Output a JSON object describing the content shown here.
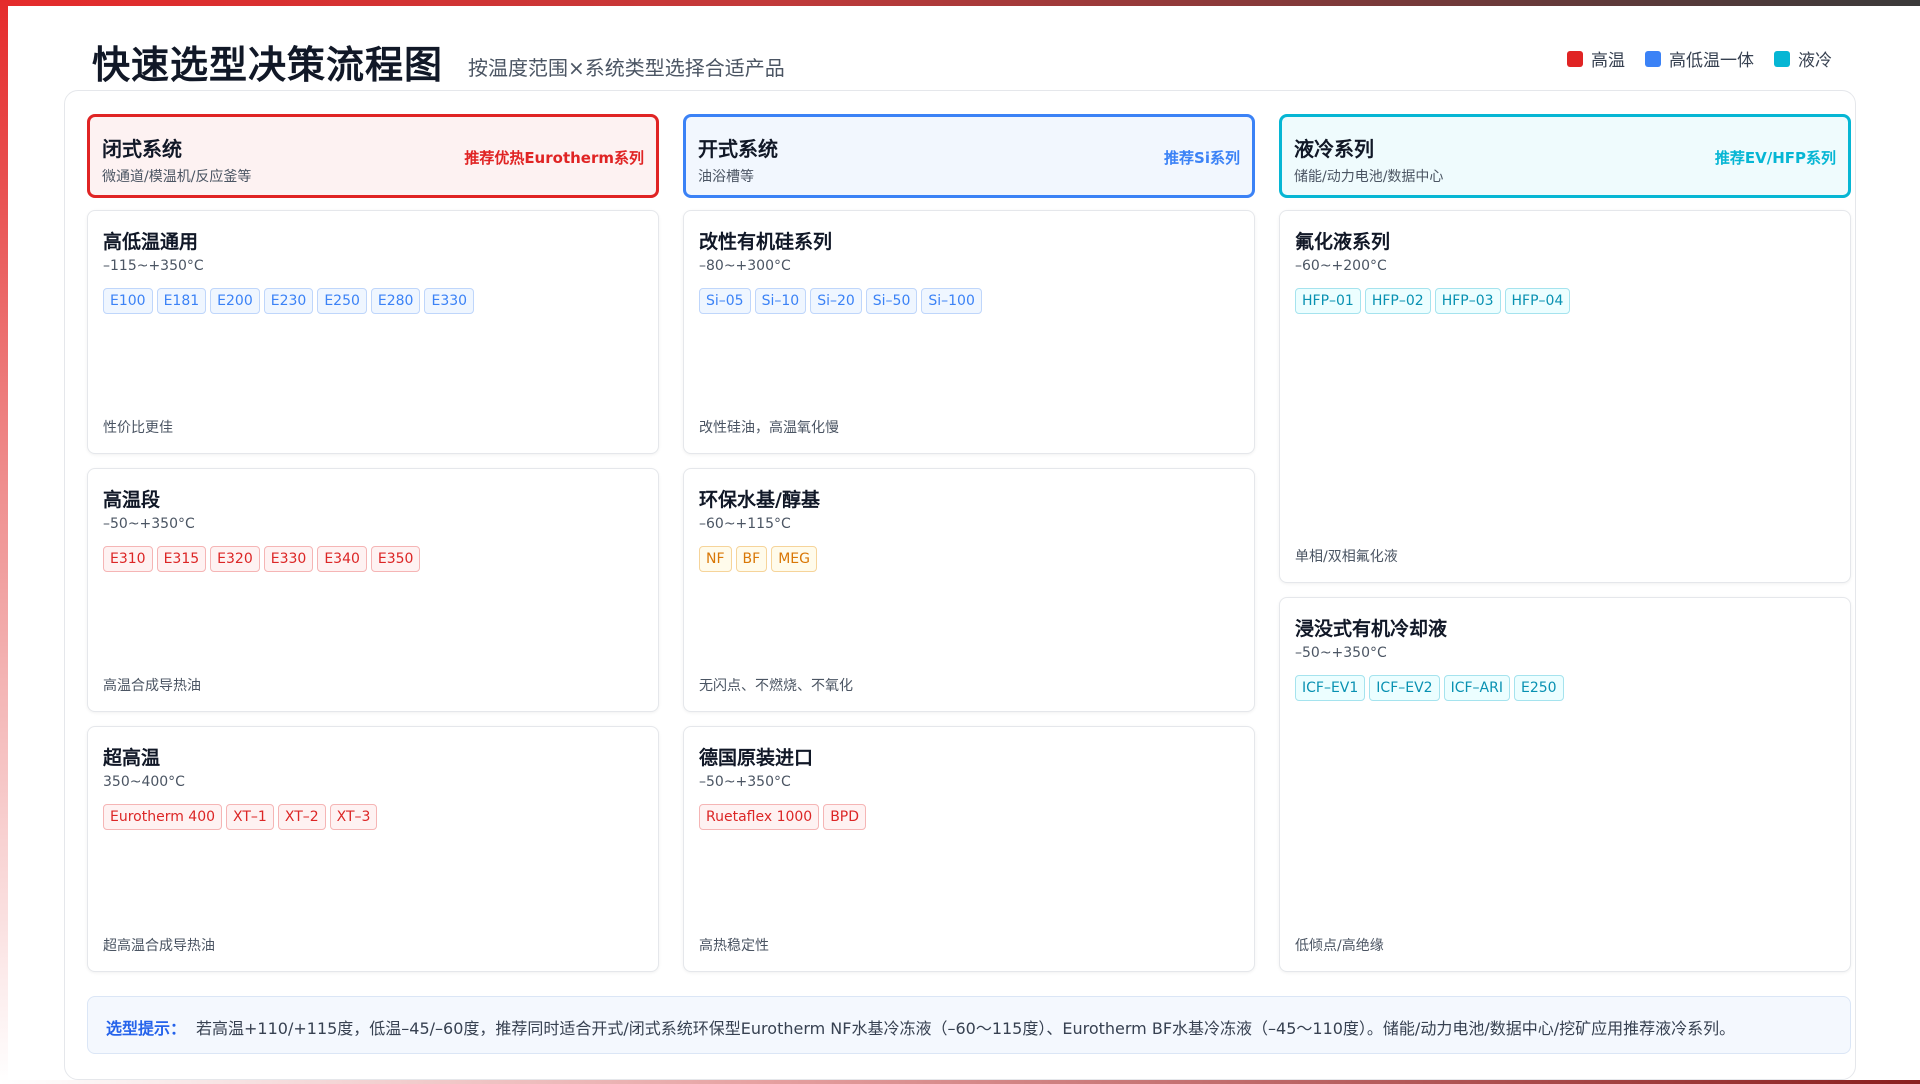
{
  "header": {
    "title": "快速选型决策流程图",
    "subtitle": "按温度范围×系统类型选择合适产品"
  },
  "legend": [
    {
      "label": "高温",
      "color": "#e02424"
    },
    {
      "label": "高低温一体",
      "color": "#3b82f6"
    },
    {
      "label": "液冷",
      "color": "#06b6d4"
    }
  ],
  "columns": [
    {
      "title": "闭式系统",
      "desc": "微通道/模温机/反应釜等",
      "recommend": "推荐优热Eurotherm系列",
      "accent": "#e02424",
      "header_bg": "#fdf2f2",
      "cards": [
        {
          "title": "高低温通用",
          "range": "–115~+350°C",
          "tags": [
            "E100",
            "E181",
            "E200",
            "E230",
            "E250",
            "E280",
            "E330"
          ],
          "tag_style": "blue",
          "note": "性价比更佳"
        },
        {
          "title": "高温段",
          "range": "–50~+350°C",
          "tags": [
            "E310",
            "E315",
            "E320",
            "E330",
            "E340",
            "E350"
          ],
          "tag_style": "red",
          "note": "高温合成导热油"
        },
        {
          "title": "超高温",
          "range": "350~400°C",
          "tags": [
            "Eurotherm 400",
            "XT–1",
            "XT–2",
            "XT–3"
          ],
          "tag_style": "red",
          "note": "超高温合成导热油"
        }
      ]
    },
    {
      "title": "开式系统",
      "desc": "油浴槽等",
      "recommend": "推荐Si系列",
      "accent": "#3b82f6",
      "header_bg": "#f2f7fe",
      "cards": [
        {
          "title": "改性有机硅系列",
          "range": "–80~+300°C",
          "tags": [
            "Si–05",
            "Si–10",
            "Si–20",
            "Si–50",
            "Si–100"
          ],
          "tag_style": "blue",
          "note": "改性硅油，高温氧化慢"
        },
        {
          "title": "环保水基/醇基",
          "range": "–60~+115°C",
          "tags": [
            "NF",
            "BF",
            "MEG"
          ],
          "tag_style": "amber",
          "note": "无闪点、不燃烧、不氧化"
        },
        {
          "title": "德国原装进口",
          "range": "–50~+350°C",
          "tags": [
            "Ruetaflex 1000",
            "BPD"
          ],
          "tag_style": "red",
          "note": "高热稳定性"
        }
      ]
    },
    {
      "title": "液冷系列",
      "desc": "储能/动力电池/数据中心",
      "recommend": "推荐EV/HFP系列",
      "accent": "#06b6d4",
      "header_bg": "#effbfd",
      "cards": [
        {
          "title": "氟化液系列",
          "range": "–60~+200°C",
          "tags": [
            "HFP–01",
            "HFP–02",
            "HFP–03",
            "HFP–04"
          ],
          "tag_style": "cyan",
          "note": "单相/双相氟化液"
        },
        {
          "title": "浸没式有机冷却液",
          "range": "–50~+350°C",
          "tags": [
            "ICF–EV1",
            "ICF–EV2",
            "ICF–ARI",
            "E250"
          ],
          "tag_style": "cyan",
          "note": "低倾点/高绝缘"
        }
      ]
    }
  ],
  "tag_styles": {
    "blue": {
      "color": "#3b82f6",
      "bg": "#eff6ff",
      "border": "#bfd6fb"
    },
    "red": {
      "color": "#dc2626",
      "bg": "#fef2f2",
      "border": "#f5b5b5"
    },
    "amber": {
      "color": "#d97706",
      "bg": "#fffbeb",
      "border": "#f6d49a"
    },
    "cyan": {
      "color": "#0891b2",
      "bg": "#ecfeff",
      "border": "#a5e3ee"
    }
  },
  "tip": {
    "label": "选型提示：",
    "text": "若高温+110/+115度，低温–45/–60度，推荐同时适合开式/闭式系统环保型Eurotherm NF水基冷冻液（–60～115度）、Eurotherm BF水基冷冻液（–45～110度）。储能/动力电池/数据中心/挖矿应用推荐液冷系列。"
  }
}
